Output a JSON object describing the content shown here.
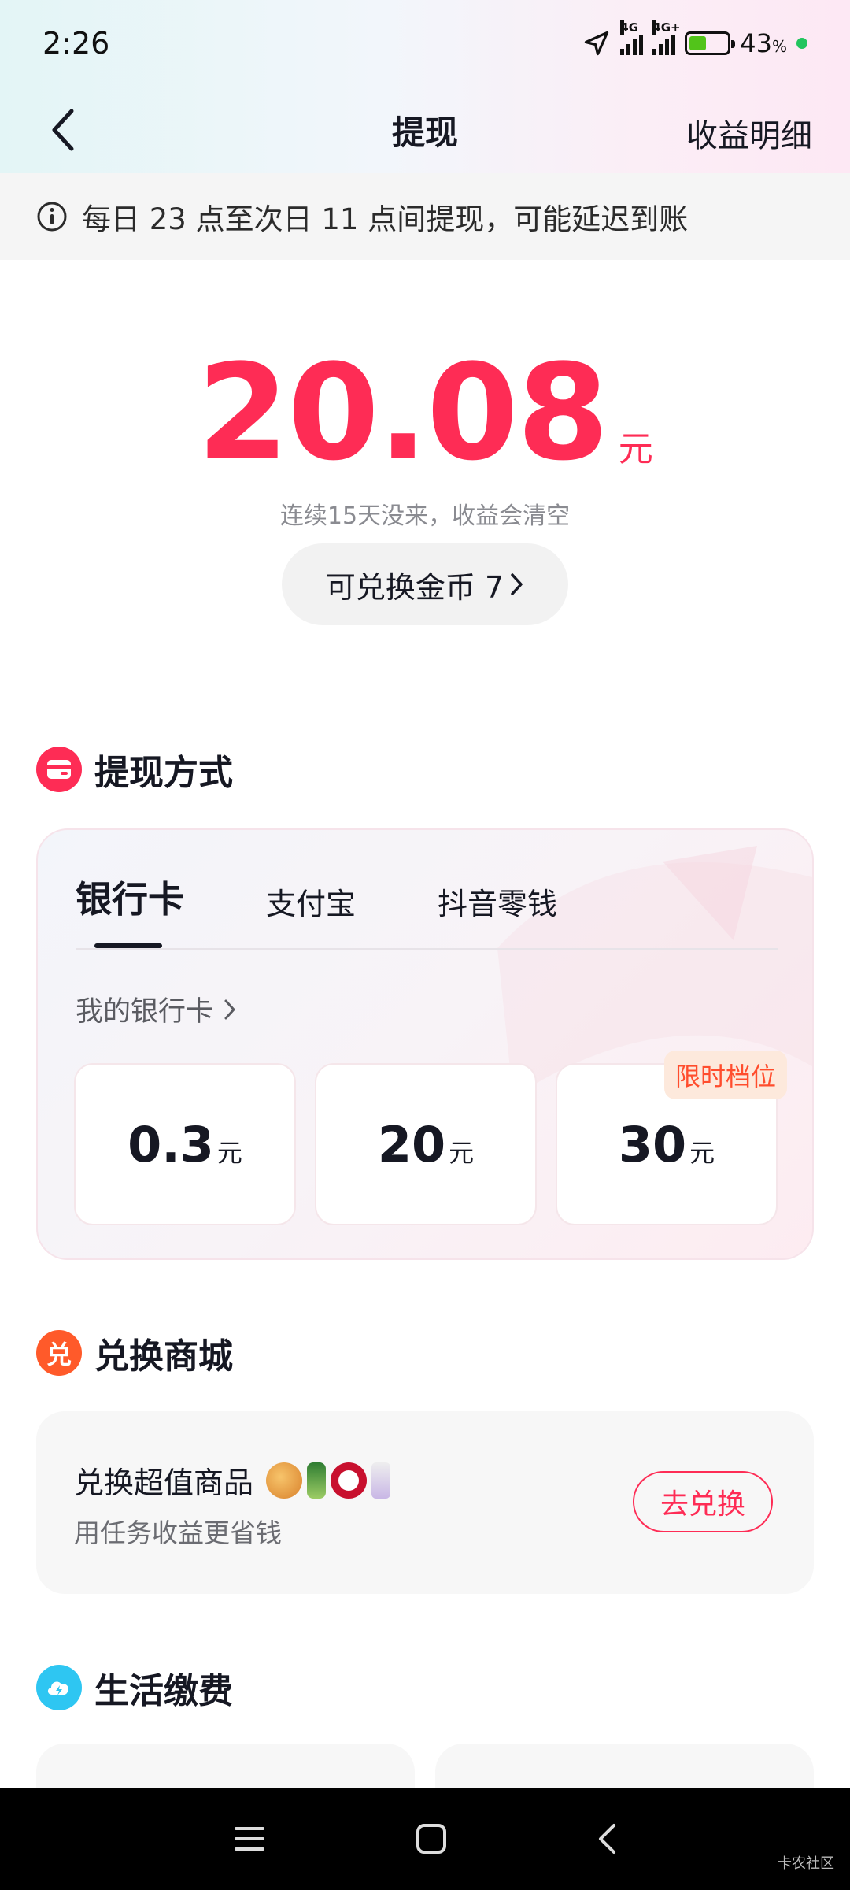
{
  "status_bar": {
    "time": "2:26",
    "network_1": "4G",
    "network_2": "4G+",
    "battery_percent": "43",
    "battery_unit": "%"
  },
  "nav": {
    "title": "提现",
    "right_link": "收益明细"
  },
  "notice": {
    "text": "每日 23 点至次日 11 点间提现，可能延迟到账"
  },
  "balance": {
    "amount": "20.08",
    "unit": "元",
    "subtitle": "连续15天没来，收益会清空",
    "coin_button": "可兑换金币 7"
  },
  "withdraw": {
    "section_title": "提现方式",
    "tabs": [
      {
        "label": "银行卡",
        "active": true
      },
      {
        "label": "支付宝",
        "active": false
      },
      {
        "label": "抖音零钱",
        "active": false
      }
    ],
    "bank_link": "我的银行卡",
    "amounts": [
      {
        "value": "0.3",
        "unit": "元"
      },
      {
        "value": "20",
        "unit": "元"
      },
      {
        "value": "30",
        "unit": "元",
        "badge": "限时档位"
      }
    ]
  },
  "exchange": {
    "section_title": "兑换商城",
    "section_icon_char": "兑",
    "title": "兑换超值商品",
    "subtitle": "用任务收益更省钱",
    "button": "去兑换"
  },
  "life": {
    "section_title": "生活缴费"
  },
  "watermark": "卡农社区",
  "colors": {
    "accent": "#fe2c55",
    "badge_text": "#ff4d2d",
    "exchange_icon": "#ff5a2a",
    "life_icon": "#2ec6f2"
  }
}
